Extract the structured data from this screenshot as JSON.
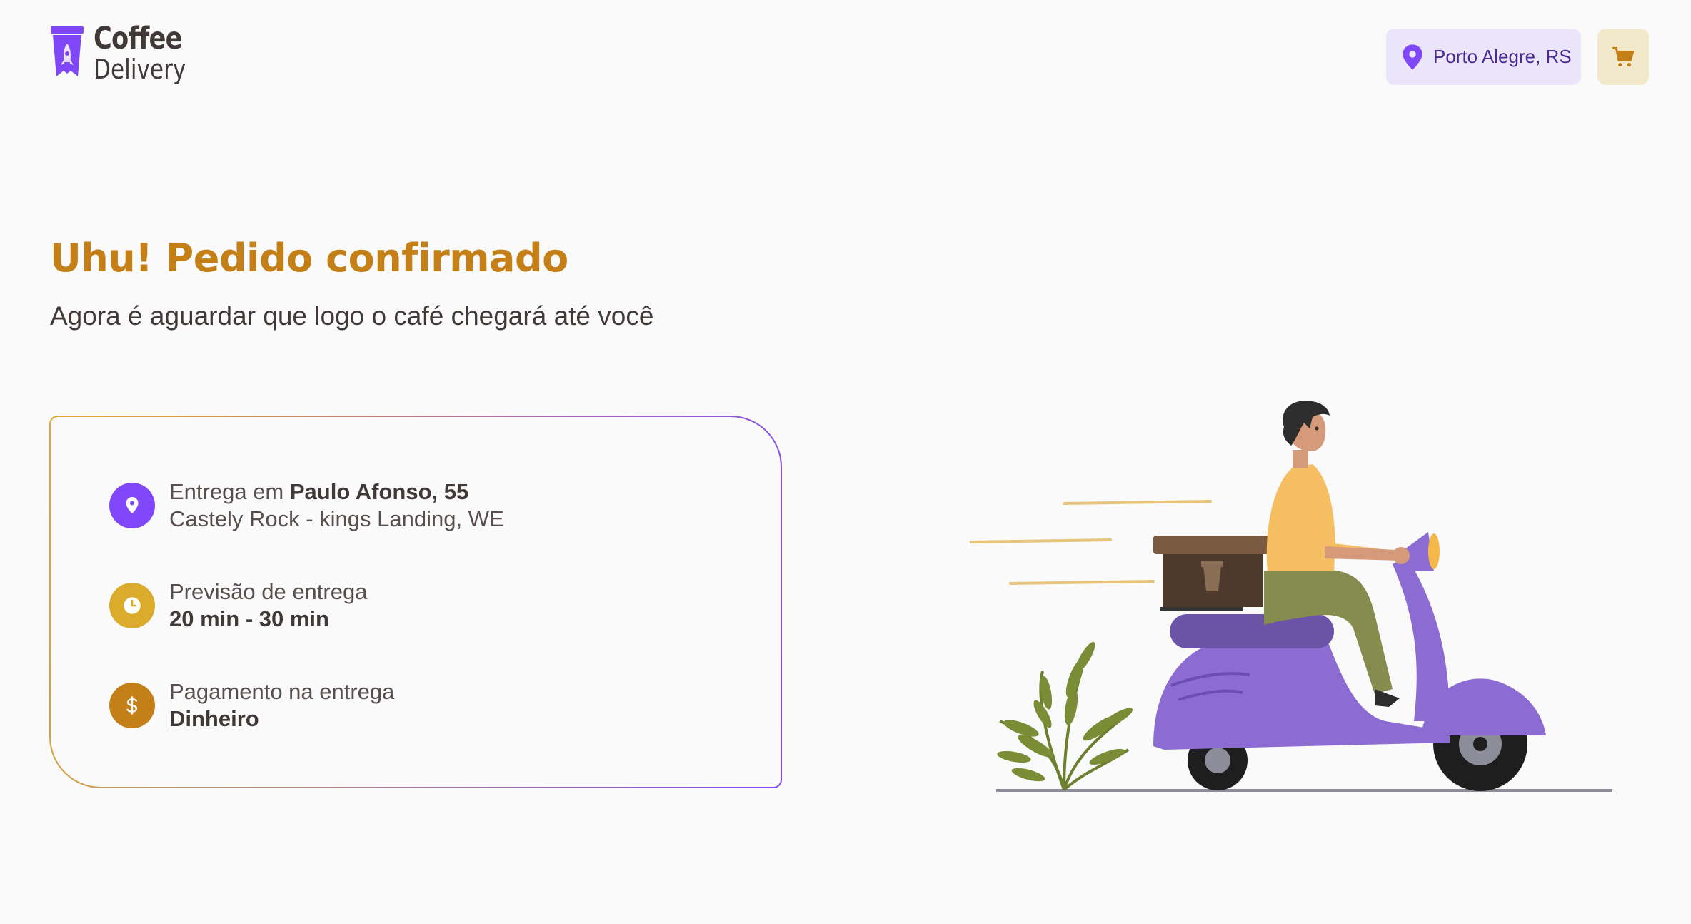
{
  "header": {
    "logo": {
      "line1": "Coffee",
      "line2": "Delivery"
    },
    "location": "Porto Alegre, RS",
    "icons": {
      "location": "map-pin-icon",
      "cart": "shopping-cart-icon"
    }
  },
  "main": {
    "title": "Uhu! Pedido confirmado",
    "subtitle": "Agora é aguardar que logo o café chegará até você"
  },
  "order_info": {
    "address": {
      "prefix": "Entrega em ",
      "street": "Paulo Afonso, 55",
      "city_line": "Castely Rock - kings Landing, WE",
      "icon": "map-pin-icon",
      "icon_color": "#8047F8"
    },
    "delivery_time": {
      "label": "Previsão de entrega",
      "value": "20 min - 30 min",
      "icon": "timer-icon",
      "icon_color": "#DBAC2C"
    },
    "payment": {
      "label": "Pagamento na entrega",
      "value": "Dinheiro",
      "icon": "currency-dollar-icon",
      "icon_color": "#C47F17"
    }
  },
  "colors": {
    "purple": "#8047F8",
    "purple_dark": "#4B2995",
    "purple_light": "#EBE5F9",
    "yellow": "#DBAC2C",
    "yellow_dark": "#C47F17",
    "yellow_light": "#F1E9C9",
    "background": "#FAFAFA"
  },
  "illustration": {
    "name": "delivery-man-on-scooter"
  }
}
